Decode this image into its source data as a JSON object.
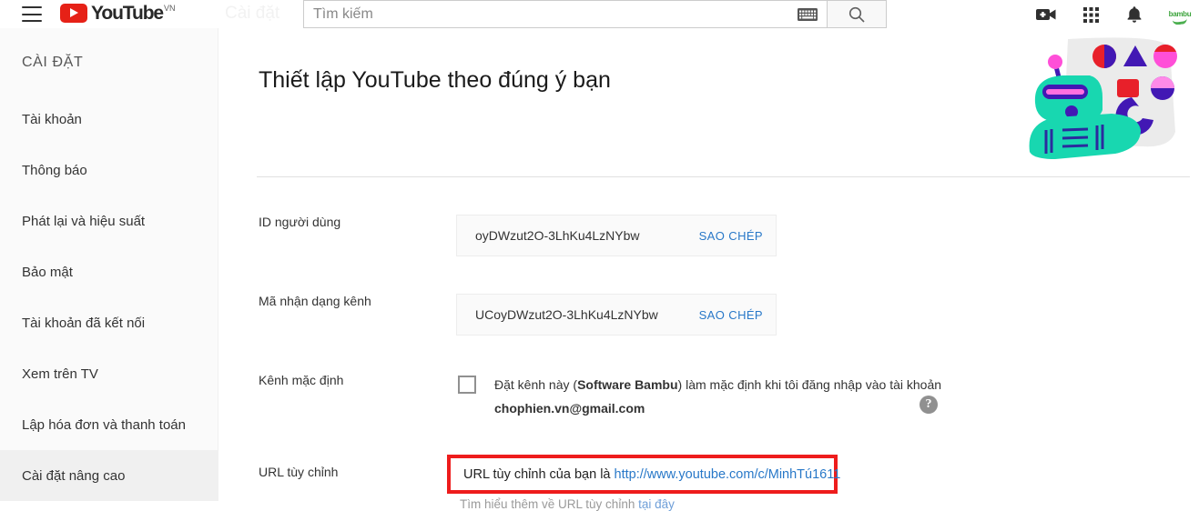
{
  "header": {
    "menu_icon": "hamburger-icon",
    "logo_word": "YouTube",
    "logo_country": "VN",
    "ghost_heading": "Cài đặt",
    "search": {
      "value": "",
      "placeholder": "Tìm kiếm",
      "keyboard_icon": "keyboard-icon",
      "search_icon": "search-icon"
    },
    "icons": {
      "upload": "video-upload-icon",
      "apps": "apps-grid-icon",
      "notifications": "bell-icon"
    },
    "avatar_label": "bambu"
  },
  "sidebar": {
    "title": "CÀI ĐẶT",
    "items": [
      {
        "label": "Tài khoản",
        "selected": false
      },
      {
        "label": "Thông báo",
        "selected": false
      },
      {
        "label": "Phát lại và hiệu suất",
        "selected": false
      },
      {
        "label": "Bảo mật",
        "selected": false
      },
      {
        "label": "Tài khoản đã kết nối",
        "selected": false
      },
      {
        "label": "Xem trên TV",
        "selected": false
      },
      {
        "label": "Lập hóa đơn và thanh toán",
        "selected": false
      },
      {
        "label": "Cài đặt nâng cao",
        "selected": true
      }
    ]
  },
  "main": {
    "page_title": "Thiết lập YouTube theo đúng ý bạn",
    "illustration": "robot-juggling-shapes-illustration",
    "rows": {
      "user_id": {
        "label": "ID người dùng",
        "value": "oyDWzut2O-3LhKu4LzNYbw",
        "copy_label": "SAO CHÉP"
      },
      "channel_id": {
        "label": "Mã nhận dạng kênh",
        "value": "UCoyDWzut2O-3LhKu4LzNYbw",
        "copy_label": "SAO CHÉP"
      },
      "default_channel": {
        "label": "Kênh mặc định",
        "checked": false,
        "text_before": "Đặt kênh này (",
        "text_bold": "Software Bambu",
        "text_after": ") làm mặc định khi tôi đăng nhập vào tài khoản ",
        "email": "chophien.vn@gmail.com",
        "help_icon": "help-question-icon"
      },
      "custom_url": {
        "label": "URL tùy chỉnh",
        "sentence_prefix": "URL tùy chỉnh của bạn là ",
        "url": "http://www.youtube.com/c/MinhTú1611",
        "sub_text": "Tìm hiểu thêm về URL tùy chỉnh ",
        "sub_link": "tại đây",
        "highlight_color": "#ee1c1c"
      }
    }
  }
}
